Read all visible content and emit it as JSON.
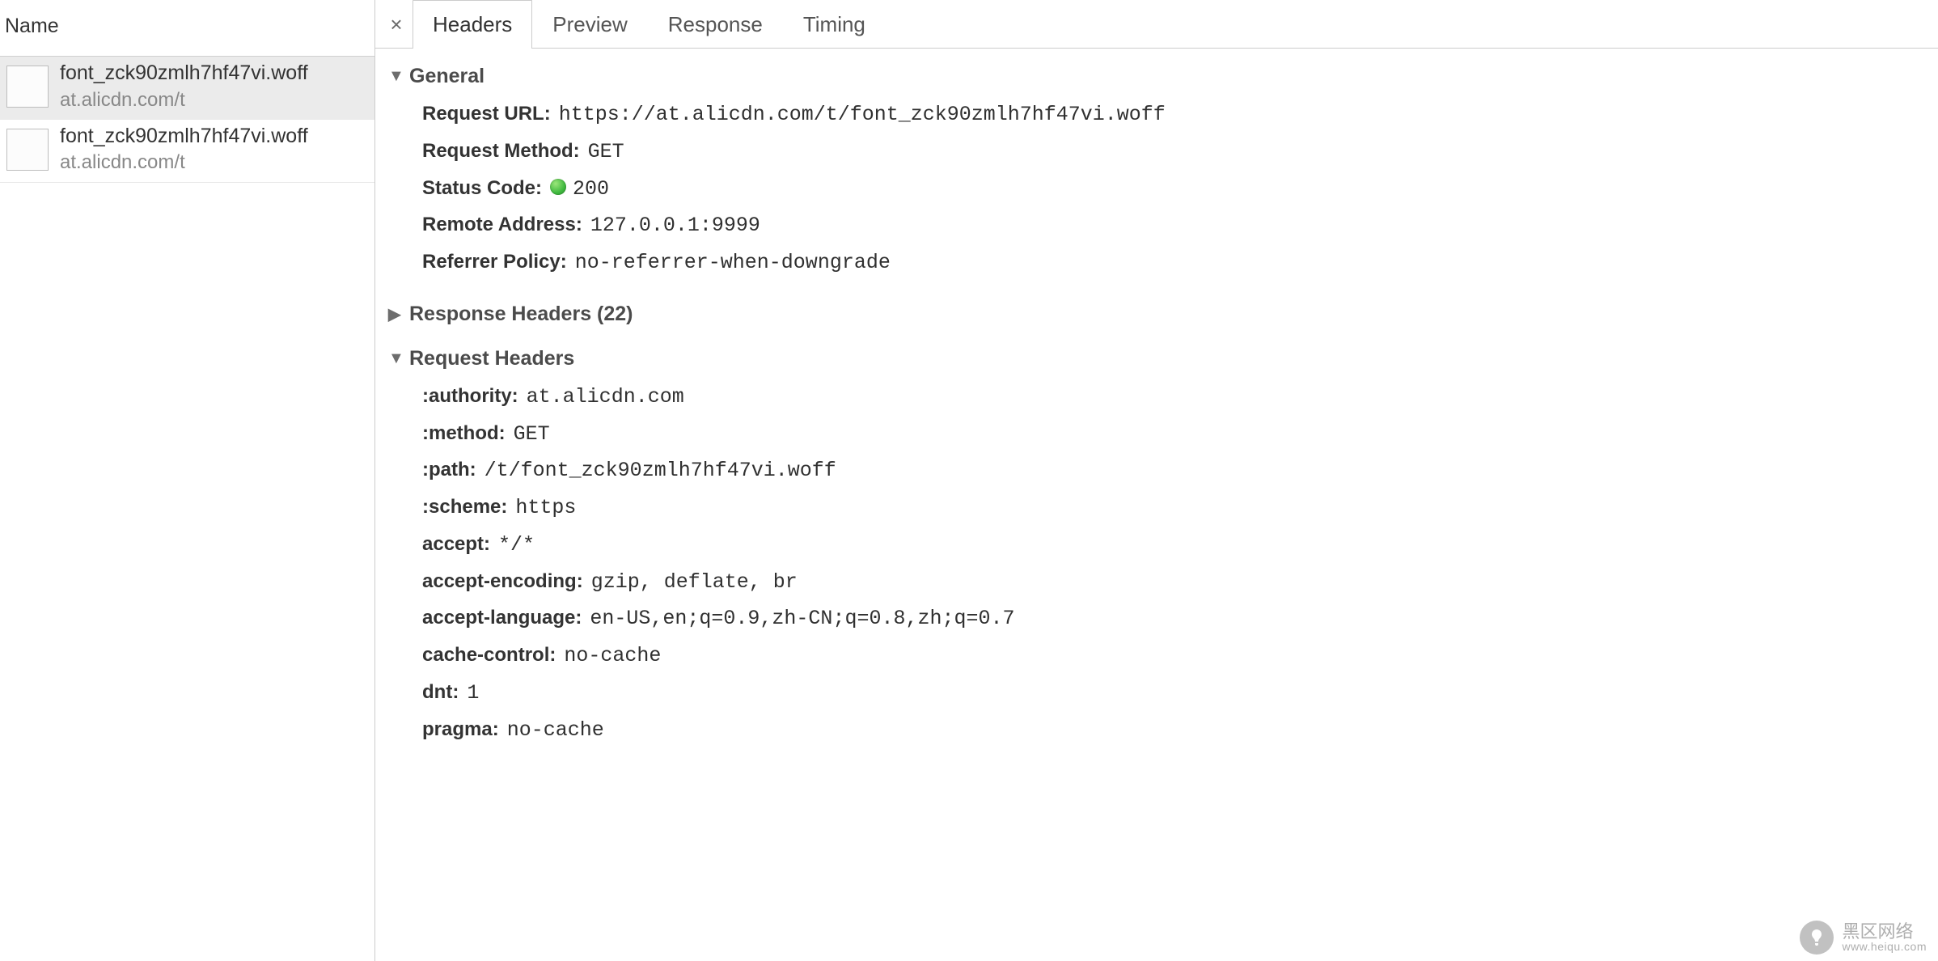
{
  "left": {
    "header": "Name",
    "requests": [
      {
        "primary": "font_zck90zmlh7hf47vi.woff",
        "secondary": "at.alicdn.com/t",
        "selected": true
      },
      {
        "primary": "font_zck90zmlh7hf47vi.woff",
        "secondary": "at.alicdn.com/t",
        "selected": false
      }
    ]
  },
  "tabs": {
    "close": "×",
    "items": [
      {
        "label": "Headers",
        "active": true
      },
      {
        "label": "Preview",
        "active": false
      },
      {
        "label": "Response",
        "active": false
      },
      {
        "label": "Timing",
        "active": false
      }
    ]
  },
  "sections": {
    "general": {
      "title": "General",
      "expanded": true,
      "rows": [
        {
          "key": "Request URL",
          "value": "https://at.alicdn.com/t/font_zck90zmlh7hf47vi.woff"
        },
        {
          "key": "Request Method",
          "value": "GET"
        },
        {
          "key": "Status Code",
          "value": "200",
          "statusDot": true
        },
        {
          "key": "Remote Address",
          "value": "127.0.0.1:9999"
        },
        {
          "key": "Referrer Policy",
          "value": "no-referrer-when-downgrade"
        }
      ]
    },
    "responseHeaders": {
      "title": "Response Headers (22)",
      "expanded": false
    },
    "requestHeaders": {
      "title": "Request Headers",
      "expanded": true,
      "rows": [
        {
          "key": ":authority",
          "value": "at.alicdn.com"
        },
        {
          "key": ":method",
          "value": "GET"
        },
        {
          "key": ":path",
          "value": "/t/font_zck90zmlh7hf47vi.woff"
        },
        {
          "key": ":scheme",
          "value": "https"
        },
        {
          "key": "accept",
          "value": "*/*"
        },
        {
          "key": "accept-encoding",
          "value": "gzip, deflate, br"
        },
        {
          "key": "accept-language",
          "value": "en-US,en;q=0.9,zh-CN;q=0.8,zh;q=0.7"
        },
        {
          "key": "cache-control",
          "value": "no-cache"
        },
        {
          "key": "dnt",
          "value": "1"
        },
        {
          "key": "pragma",
          "value": "no-cache"
        }
      ]
    }
  },
  "watermark": {
    "cn": "黑区网络",
    "url": "www.heiqu.com"
  }
}
